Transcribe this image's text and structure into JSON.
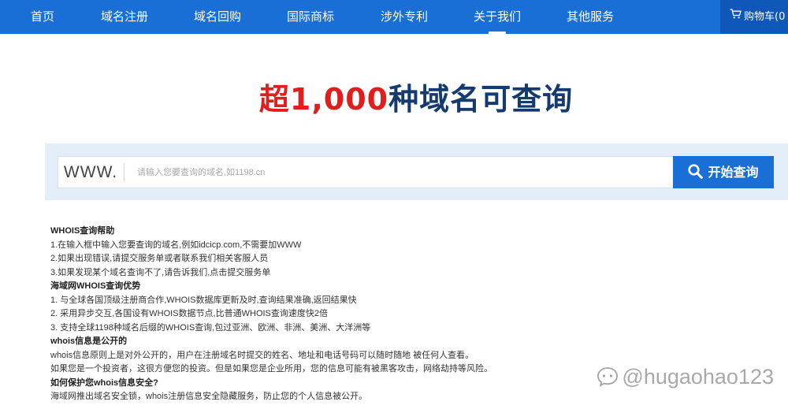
{
  "nav": {
    "items": [
      {
        "label": "首页"
      },
      {
        "label": "域名注册"
      },
      {
        "label": "域名回购"
      },
      {
        "label": "国际商标"
      },
      {
        "label": "涉外专利"
      },
      {
        "label": "关于我们"
      },
      {
        "label": "其他服务"
      }
    ],
    "active_index": 5,
    "cart_label": "购物车(0",
    "cart_icon": "shopping-cart-icon"
  },
  "headline": {
    "prefix": "超",
    "highlight": "1,000",
    "suffix": "种域名可查询"
  },
  "search": {
    "prefix": "WWW.",
    "placeholder": "请输入您要查询的域名,如1198.cn",
    "value": "",
    "button_label": "开始查询",
    "button_icon": "search-icon"
  },
  "help": {
    "lines": [
      {
        "text": "WHOIS查询帮助",
        "heading": true
      },
      {
        "text": "1.在输入框中输入您要查询的域名,例如idcicp.com,不需要加WWW",
        "heading": false
      },
      {
        "text": "2.如果出现错误,请提交服务单或者联系我们相关客服人员",
        "heading": false
      },
      {
        "text": "3.如果发现某个域名查询不了,请告诉我们,点击提交服务单",
        "heading": false
      },
      {
        "text": "海域网WHOIS查询优势",
        "heading": true
      },
      {
        "text": "1. 与全球各国顶级注册商合作,WHOIS数据库更新及时,查询结果准确,返回结果快",
        "heading": false
      },
      {
        "text": "2. 采用异步交互,各国设有WHOIS数据节点,比普通WHOIS查询速度快2倍",
        "heading": false
      },
      {
        "text": "3. 支持全球1198种域名后缀的WHOIS查询,包过亚洲、欧洲、非洲、美洲、大洋洲等",
        "heading": false
      },
      {
        "text": "whois信息是公开的",
        "heading": true
      },
      {
        "text": "whois信息原则上是对外公开的，用户在注册域名时提交的姓名、地址和电话号码可以随时随地 被任何人查看。",
        "heading": false
      },
      {
        "text": "如果您是一个投资者，这很方便您的投资。但是如果您是企业所用，您的信息可能有被黑客攻击，网络劫持等风险。",
        "heading": false
      },
      {
        "text": "如何保护您whois信息安全?",
        "heading": true
      },
      {
        "text": "海域网推出域名安全锁，whois注册信息安全隐藏服务，防止您的个人信息被公开。",
        "heading": false
      }
    ]
  },
  "watermark": {
    "text": "@hugaohao123",
    "icon": "zhihu-logo-icon"
  },
  "colors": {
    "nav_bg": "#1a6fd6",
    "cart_bg": "#0f57b8",
    "headline_red": "#e01e1e",
    "headline_navy": "#143a6e",
    "search_band_bg": "#e3eef9",
    "button_bg": "#1a6fd6"
  }
}
